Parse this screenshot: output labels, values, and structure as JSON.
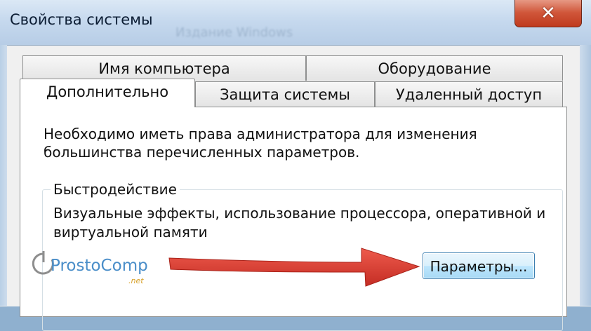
{
  "window": {
    "title": "Свойства системы",
    "title_ghost": "Издание Windows",
    "close_symbol": "✕"
  },
  "tabs": {
    "row1": [
      {
        "label": "Имя компьютера"
      },
      {
        "label": "Оборудование"
      }
    ],
    "row2": [
      {
        "label": "Дополнительно",
        "active": true
      },
      {
        "label": "Защита системы"
      },
      {
        "label": "Удаленный доступ"
      }
    ]
  },
  "panel": {
    "info_text": "Необходимо иметь права администратора для изменения большинства перечисленных параметров.",
    "group": {
      "label": "Быстродействие",
      "description": "Визуальные эффекты, использование процессора, оперативной и виртуальной памяти",
      "button_label": "Параметры..."
    }
  },
  "watermark": {
    "text": "ProstoComp",
    "sub": ".net"
  },
  "colors": {
    "close_button": "#c9462a",
    "arrow": "#d93a2f",
    "button_border": "#3c7fb1",
    "logo": "#4a8ec9"
  }
}
